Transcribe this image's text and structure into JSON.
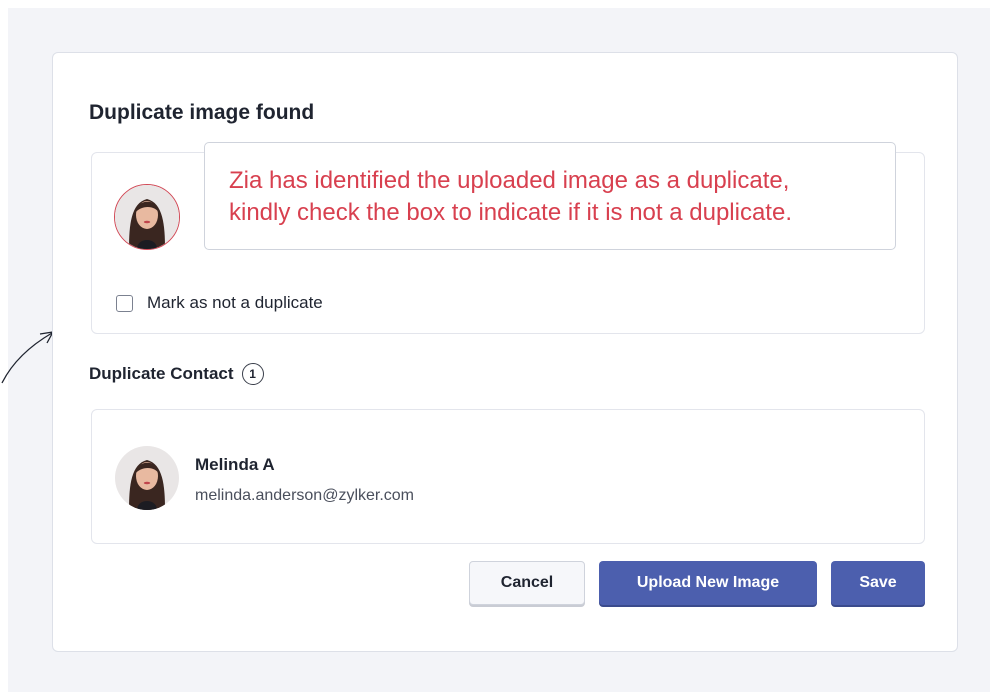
{
  "dialog": {
    "title": "Duplicate image found",
    "uploaded_image": {
      "alt": "uploaded-photo"
    },
    "callout": {
      "line1": "Zia has identified the uploaded image as a duplicate,",
      "line2": "kindly check the box to indicate if it is not a duplicate.",
      "color": "#d8404f"
    },
    "checkbox": {
      "label": "Mark as not a duplicate",
      "checked": false
    }
  },
  "duplicates": {
    "heading": "Duplicate Contact",
    "count": "1",
    "contacts": [
      {
        "name": "Melinda A",
        "email": "melinda.anderson@zylker.com"
      }
    ]
  },
  "actions": {
    "cancel": "Cancel",
    "upload": "Upload New Image",
    "save": "Save",
    "primary_color": "#4c5fae"
  }
}
